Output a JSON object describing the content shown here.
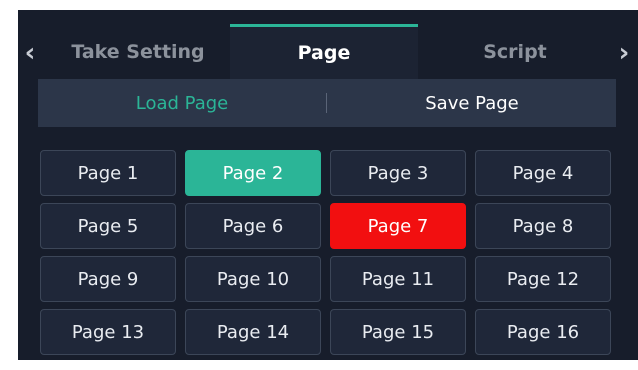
{
  "tabs": {
    "left_arrow": "‹",
    "right_arrow": "›",
    "items": [
      {
        "label": "Take Setting"
      },
      {
        "label": "Page"
      },
      {
        "label": "Script"
      }
    ]
  },
  "actions": {
    "load_label": "Load Page",
    "save_label": "Save Page"
  },
  "pages": [
    {
      "label": "Page 1"
    },
    {
      "label": "Page 2"
    },
    {
      "label": "Page 3"
    },
    {
      "label": "Page 4"
    },
    {
      "label": "Page 5"
    },
    {
      "label": "Page 6"
    },
    {
      "label": "Page 7"
    },
    {
      "label": "Page 8"
    },
    {
      "label": "Page 9"
    },
    {
      "label": "Page 10"
    },
    {
      "label": "Page 11"
    },
    {
      "label": "Page 12"
    },
    {
      "label": "Page 13"
    },
    {
      "label": "Page 14"
    },
    {
      "label": "Page 15"
    },
    {
      "label": "Page 16"
    }
  ],
  "colors": {
    "accent_green": "#2bb597",
    "accent_red": "#f20f10",
    "panel_bg": "#171d2b"
  }
}
